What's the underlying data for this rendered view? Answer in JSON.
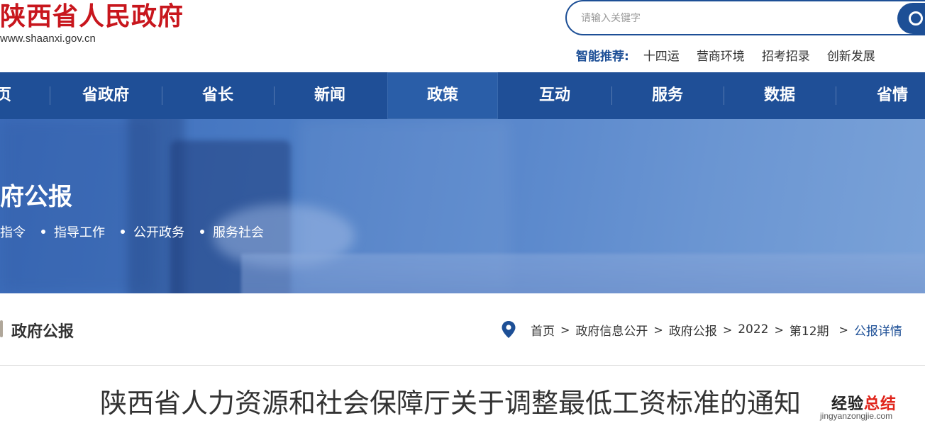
{
  "header": {
    "site_title": "陕西省人民政府",
    "site_url": "www.shaanxi.gov.cn",
    "search_placeholder": "请输入关键字",
    "recommend_label": "智能推荐:",
    "recommend_links": [
      "十四运",
      "营商环境",
      "招考招录",
      "创新发展"
    ]
  },
  "nav": {
    "items": [
      "页",
      "省政府",
      "省长",
      "新闻",
      "政策",
      "互动",
      "服务",
      "数据",
      "省情"
    ],
    "active_index": 4
  },
  "banner": {
    "title": "府公报",
    "links": [
      "指令",
      "指导工作",
      "公开政务",
      "服务社会"
    ]
  },
  "section": {
    "title": "政府公报",
    "breadcrumb": [
      "首页",
      "政府信息公开",
      "政府公报",
      "2022",
      "第12期",
      "公报详情"
    ]
  },
  "article": {
    "title": "陕西省人力资源和社会保障厅关于调整最低工资标准的通知"
  },
  "watermark": {
    "text_main": "经验",
    "text_accent": "总结",
    "url": "jingyanzongjie.com"
  },
  "colors": {
    "brand_red": "#c8161d",
    "nav_blue": "#1f4f97",
    "link_blue": "#1d4f96"
  }
}
